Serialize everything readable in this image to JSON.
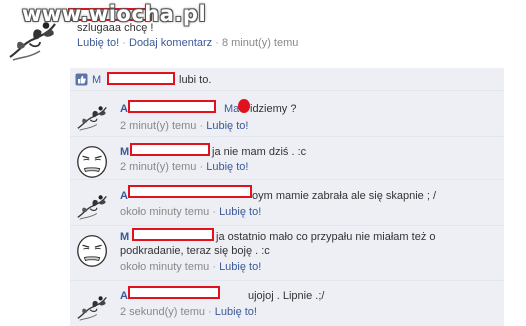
{
  "watermark": "www.wiocha.pl",
  "post": {
    "text": "szlugaaa chcę !",
    "like_link": "Lubię to!",
    "comment_link": "Dodaj komentarz",
    "time": "8 minut(y) temu"
  },
  "likes": {
    "prefix": "M",
    "suffix": "lubi to."
  },
  "comments": [
    {
      "author_initial": "A",
      "text_pre": "Ma",
      "text": "idziemy ?",
      "time": "2 minut(y) temu",
      "like": "Lubię to!"
    },
    {
      "author_initial": "M",
      "text": "ja nie mam dziś . :c",
      "time": "2 minut(y) temu",
      "like": "Lubię to!"
    },
    {
      "author_initial": "A",
      "text": "oym mamie zabrała ale się skapnie ; /",
      "time": "około minuty temu",
      "like": "Lubię to!"
    },
    {
      "author_initial": "M",
      "text": "ja ostatnio mało co przypału nie miałam też o",
      "text2": "podkradanie, teraz się boję . :c",
      "time": "około minuty temu",
      "like": "Lubię to!"
    },
    {
      "author_initial": "A",
      "text": "ujojoj . Lipnie .;/",
      "time": "2 sekund(y) temu",
      "like": "Lubię to!"
    }
  ],
  "meta_separator": "·",
  "icons": {
    "like": "thumbs-up-icon",
    "avatar_a": "flower-sketch-avatar",
    "avatar_m": "meme-face-avatar"
  },
  "colors": {
    "link": "#3b5998",
    "comment_bg": "#edeff4",
    "redaction": "#e0121e"
  }
}
